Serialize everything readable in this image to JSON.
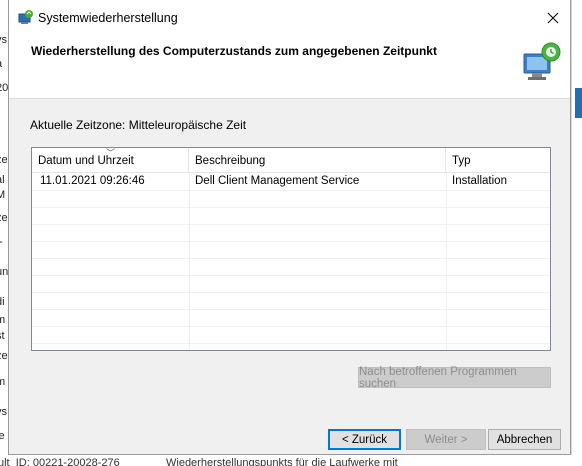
{
  "background": {
    "left_fragments": [
      "vs",
      "a",
      "20",
      "ze",
      "al",
      "M",
      "ze",
      "t-",
      "un",
      "di",
      "m",
      "st",
      "ze",
      "m",
      "vs",
      "ie"
    ],
    "bottom_fragments": [
      "ult_ID: 00221-20028-276",
      "Wiederherstellungspunkts für die Laufwerke mit"
    ]
  },
  "dialog": {
    "title": "Systemwiederherstellung",
    "header_title": "Wiederherstellung des Computerzustands zum angegebenen Zeitpunkt",
    "timezone": "Aktuelle Zeitzone: Mitteleuropäische Zeit",
    "columns": [
      "Datum und Uhrzeit",
      "Beschreibung",
      "Typ"
    ],
    "rows": [
      {
        "date": "11.01.2021 09:26:46",
        "description": "Dell Client Management Service",
        "type": "Installation"
      }
    ],
    "scan_button": "Nach betroffenen Programmen suchen",
    "back_button": "< Zurück",
    "next_button": "Weiter >",
    "cancel_button": "Abbrechen"
  },
  "icons": [
    "restore-icon",
    "close-icon",
    "restore-computer-icon",
    "sort-arrow-icon"
  ],
  "colors": {
    "accent": "#0078d7",
    "background_blue": "#1f6fb2",
    "dialog_bg": "#f0f0f0"
  }
}
